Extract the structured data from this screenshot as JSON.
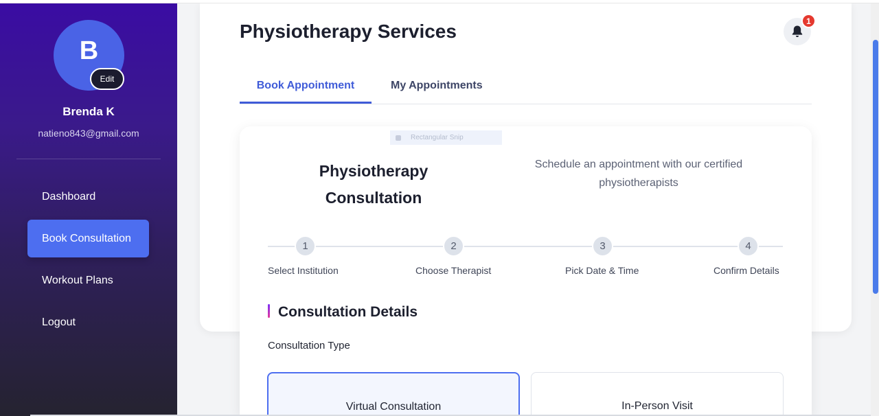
{
  "sidebar": {
    "avatar_letter": "B",
    "edit_label": "Edit",
    "user_name": "Brenda K",
    "user_email": "natieno843@gmail.com",
    "nav": [
      {
        "label": "Dashboard"
      },
      {
        "label": "Book Consultation"
      },
      {
        "label": "Workout Plans"
      },
      {
        "label": "Logout"
      }
    ]
  },
  "header": {
    "title": "Physiotherapy Services",
    "notification_count": "1",
    "icon": "bell-icon"
  },
  "tabs": [
    {
      "label": "Book Appointment"
    },
    {
      "label": "My Appointments"
    }
  ],
  "overlay": {
    "snip_label": "Rectangular Snip"
  },
  "panel": {
    "title": "Physiotherapy Consultation",
    "subtitle": "Schedule an appointment with our certified physiotherapists",
    "steps": [
      {
        "number": "1",
        "label": "Select Institution"
      },
      {
        "number": "2",
        "label": "Choose Therapist"
      },
      {
        "number": "3",
        "label": "Pick Date & Time"
      },
      {
        "number": "4",
        "label": "Confirm Details"
      }
    ],
    "section_title": "Consultation Details",
    "field_label": "Consultation Type",
    "types": [
      {
        "label": "Virtual Consultation"
      },
      {
        "label": "In-Person Visit"
      }
    ]
  },
  "colors": {
    "accent": "#4d6ef0",
    "tab_active": "#3f5bd8",
    "badge": "#e5392f",
    "sidebar_top": "#3a0ca3",
    "sidebar_bottom": "#252330"
  }
}
